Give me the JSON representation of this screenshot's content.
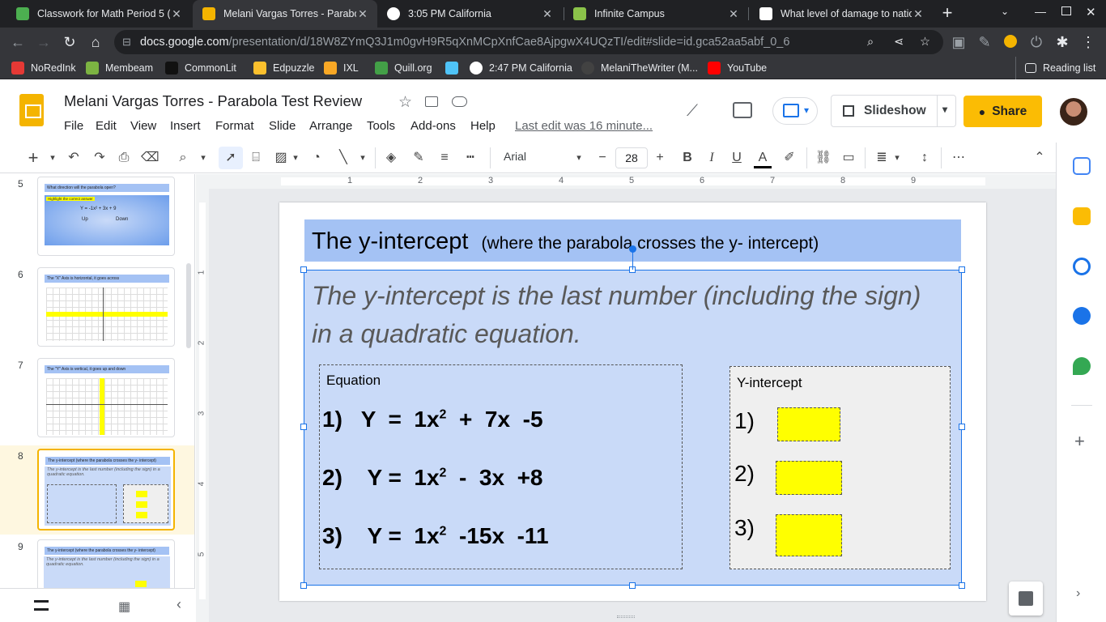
{
  "browser": {
    "tabs": [
      {
        "title": "Classwork for Math Period 5 (",
        "icon": "classroom-icon",
        "color": "#4caf50"
      },
      {
        "title": "Melani Vargas Torres - Parabo",
        "icon": "slides-icon",
        "color": "#f4b400"
      },
      {
        "title": "3:05 PM California",
        "icon": "clock-icon",
        "color": "#ffffff"
      },
      {
        "title": "Infinite Campus",
        "icon": "infinite-campus-icon",
        "color": "#8bc34a"
      },
      {
        "title": "What level of damage to natio",
        "icon": "page-icon",
        "color": "#ffffff"
      }
    ],
    "url_host": "docs.google.com",
    "url_path": "/presentation/d/18W8ZYmQ3J1m0gvH9R5qXnMCpXnfCae8AjpgwX4UQzTI/edit#slide=id.gca52aa5abf_0_6",
    "bookmarks": [
      {
        "label": "NoRedInk",
        "color": "#e53935"
      },
      {
        "label": "Membeam",
        "color": "#7cb342"
      },
      {
        "label": "CommonLit",
        "color": "#202124"
      },
      {
        "label": "Edpuzzle",
        "color": "#fbc02d"
      },
      {
        "label": "IXL",
        "color": "#f9a825"
      },
      {
        "label": "Quill.org",
        "color": "#43a047"
      },
      {
        "label": "",
        "color": "#4fc3f7"
      },
      {
        "label": "2:47 PM California",
        "color": "#ffffff"
      },
      {
        "label": "MelaniTheWriter (M...",
        "color": "#424242"
      },
      {
        "label": "YouTube",
        "color": "#ff0000"
      }
    ],
    "reading_list": "Reading list"
  },
  "docs": {
    "title": "Melani Vargas Torres - Parabola Test Review",
    "menus": [
      "File",
      "Edit",
      "View",
      "Insert",
      "Format",
      "Slide",
      "Arrange",
      "Tools",
      "Add-ons",
      "Help"
    ],
    "last_edit": "Last edit was 16 minute...",
    "slideshow_label": "Slideshow",
    "share_label": "Share",
    "font_name": "Arial",
    "font_size": "28"
  },
  "filmstrip": {
    "slides": [
      {
        "num": "5",
        "title": "What direction will the parabola open?"
      },
      {
        "num": "6",
        "title": "The \"X\" Axis is horizontal, it goes across"
      },
      {
        "num": "7",
        "title": "The \"Y\" Axis is vertical, it goes up and down"
      },
      {
        "num": "8",
        "title": "The y-intercept (where the parabola crosses the y- intercept)"
      },
      {
        "num": "9",
        "title": "The y-intercept (where the parabola crosses the y- intercept)"
      }
    ],
    "slide5_highlight": "Highlight the correct answer",
    "slide5_equation": "Y = -1x² + 3x + 9",
    "slide5_options": [
      "Up",
      "Down"
    ]
  },
  "ruler": {
    "h_ticks": [
      "1",
      "2",
      "3",
      "4",
      "5",
      "6",
      "7",
      "8",
      "9"
    ],
    "v_ticks": [
      "1",
      "2",
      "3",
      "4",
      "5"
    ]
  },
  "slide": {
    "title_main": "The y-intercept",
    "title_sub": "(where the parabola crosses the y- intercept)",
    "subtitle": "The y-intercept is the last number (including the sign) in a quadratic equation.",
    "equation_label": "Equation",
    "yintercept_label": "Y-intercept",
    "equations": [
      {
        "num": "1)",
        "lhs": "Y  =  1x",
        "rhs": "  +  7x  -5"
      },
      {
        "num": "2)",
        "lhs": " Y =  1x",
        "rhs": "  -  3x  +8"
      },
      {
        "num": "3)",
        "lhs": " Y =  1x",
        "rhs": "  -15x  -11"
      }
    ],
    "exponent": "2",
    "answer_nums": [
      "1)",
      "2)",
      "3)"
    ],
    "answer_box_color": "#ffff00"
  }
}
